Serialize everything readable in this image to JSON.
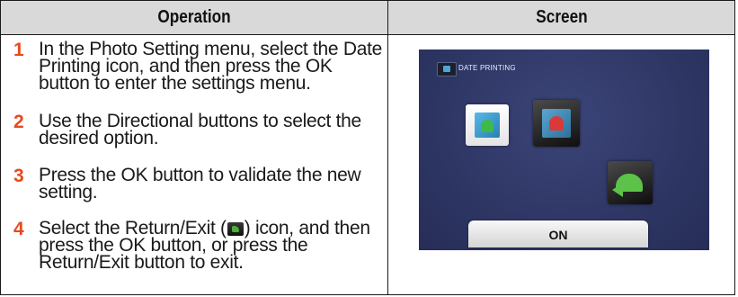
{
  "table": {
    "headers": {
      "operation": "Operation",
      "screen": "Screen"
    },
    "steps": [
      {
        "number": "1",
        "text": "In the Photo Setting menu, select the Date Printing icon, and then press the OK button to enter the settings menu."
      },
      {
        "number": "2",
        "text": "Use the Directional buttons to select the desired option."
      },
      {
        "number": "3",
        "text": "Press the OK button to validate the new setting."
      },
      {
        "number": "4",
        "text_before_icon": "Select the Return/Exit (",
        "icon": "return-exit-icon",
        "text_after_icon": ") icon, and then press the OK button, or press the Return/Exit button to exit."
      }
    ]
  },
  "screen": {
    "title_icon": "photo-setting-icon",
    "title": "DATE PRINTING",
    "options": [
      {
        "icon": "date-print-on-icon",
        "selected": true
      },
      {
        "icon": "date-print-off-icon",
        "selected": false
      }
    ],
    "return_icon": "return-icon",
    "value": "ON"
  },
  "colors": {
    "step_number": "#e8491d",
    "header_bg": "#d9d9d9",
    "screen_bg": "#2e3664"
  }
}
